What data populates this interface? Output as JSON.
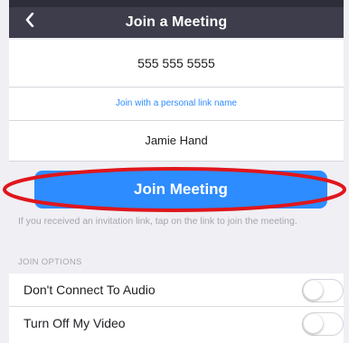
{
  "navbar": {
    "title": "Join a Meeting",
    "back_icon": "chevron-left-icon"
  },
  "form": {
    "meeting_id": "555 555 5555",
    "personal_link_text": "Join with a personal link name",
    "name": "Jamie Hand",
    "join_button_label": "Join Meeting",
    "hint": "If you received an invitation link, tap on the link to join the meeting."
  },
  "join_options": {
    "section_label": "JOIN OPTIONS",
    "items": [
      {
        "label": "Don't Connect To Audio",
        "enabled": false
      },
      {
        "label": "Turn Off My Video",
        "enabled": false
      }
    ]
  },
  "colors": {
    "navbar": "#3d3d4b",
    "accent": "#2d8cff",
    "annotation": "#e0161b"
  }
}
